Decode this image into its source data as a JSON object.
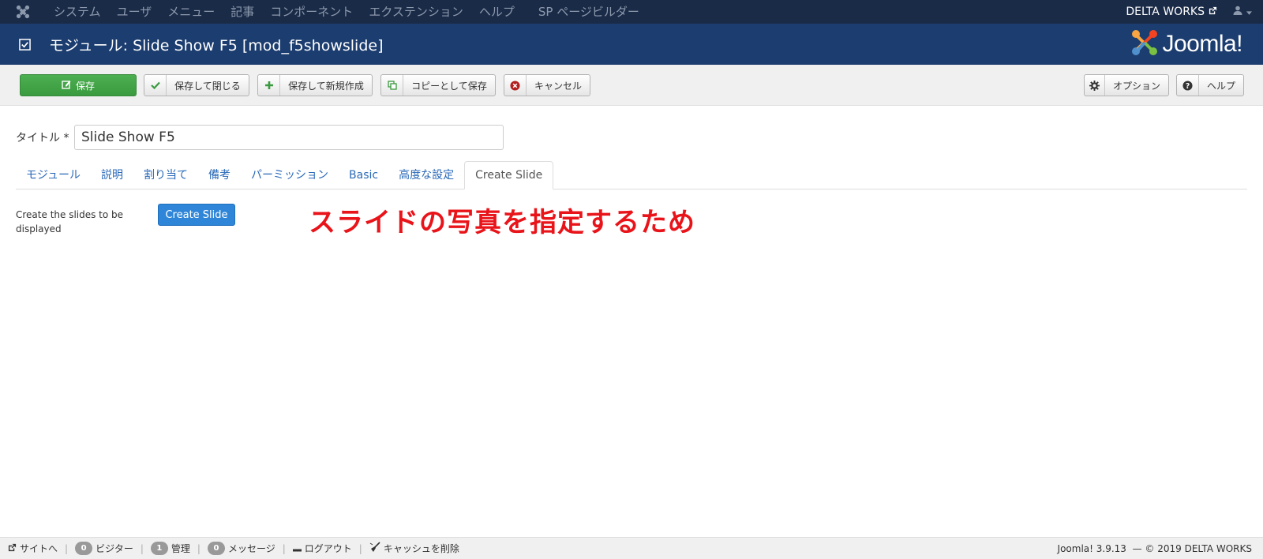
{
  "navbar": {
    "menu": [
      "システム",
      "ユーザ",
      "メニュー",
      "記事",
      "コンポーネント",
      "エクステンション",
      "ヘルプ",
      "SP ページビルダー"
    ],
    "site_name": "DELTA WORKS"
  },
  "header": {
    "title": "モジュール: Slide Show F5 [mod_f5showslide]",
    "brand": "Joomla!"
  },
  "toolbar": {
    "save": "保存",
    "save_close": "保存して閉じる",
    "save_new": "保存して新規作成",
    "save_copy": "コピーとして保存",
    "cancel": "キャンセル",
    "options": "オプション",
    "help": "ヘルプ"
  },
  "form": {
    "title_label": "タイトル",
    "required_mark": "*",
    "title_value": "Slide Show F5"
  },
  "tabs": [
    "モジュール",
    "説明",
    "割り当て",
    "備考",
    "パーミッション",
    "Basic",
    "高度な設定",
    "Create Slide"
  ],
  "create_slide": {
    "label": "Create the slides to be displayed",
    "button": "Create Slide",
    "annotation": "スライドの写真を指定するため"
  },
  "statusbar": {
    "view_site": "サイトへ",
    "visitors_count": "0",
    "visitors": "ビジター",
    "admin_count": "1",
    "admin": "管理",
    "messages_count": "0",
    "messages": "メッセージ",
    "logout": "ログアウト",
    "clear_cache": "キャッシュを削除",
    "version": "Joomla! 3.9.13",
    "copyright": "— © 2019 DELTA WORKS"
  },
  "colors": {
    "navbar_bg": "#1a2b48",
    "header_bg": "#1c3d6f",
    "save_green": "#3fa244",
    "primary_blue": "#2f86d8",
    "annotation_red": "#e8141a"
  }
}
